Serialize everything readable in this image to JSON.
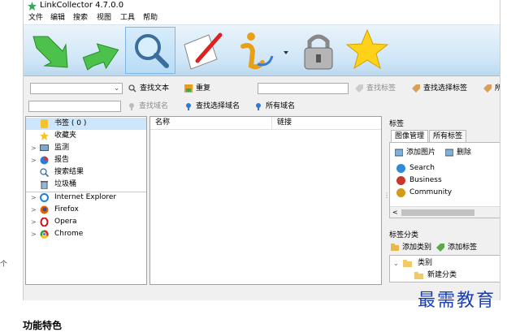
{
  "window": {
    "title": "LinkCollector 4.7.0.0"
  },
  "menu": [
    "文件",
    "编辑",
    "搜索",
    "视图",
    "工具",
    "帮助"
  ],
  "big_toolbar": [
    {
      "name": "arrow-down-right-icon"
    },
    {
      "name": "arrow-up-right-icon"
    },
    {
      "name": "magnifier-icon"
    },
    {
      "name": "paper-pencil-icon"
    },
    {
      "name": "info-icon"
    },
    {
      "name": "padlock-icon"
    },
    {
      "name": "star-icon"
    }
  ],
  "toolbar1": {
    "find_text": "查找文本",
    "duplicate": "重复",
    "find_tags": "查找标签",
    "find_selected_tags": "查找选择标签",
    "cut_label": "所"
  },
  "toolbar2": {
    "find_domain": "查找域名",
    "find_selected_domain": "查找选择域名",
    "all_domains": "所有域名"
  },
  "tree": [
    {
      "label": "书签 ( 0 )",
      "icon": "bookmark-icon",
      "arrow": "",
      "selected": true
    },
    {
      "label": "收藏夹",
      "icon": "star-icon",
      "arrow": "",
      "selected": false
    },
    {
      "label": "监测",
      "icon": "monitor-icon",
      "arrow": ">",
      "selected": false
    },
    {
      "label": "报告",
      "icon": "report-icon",
      "arrow": ">",
      "selected": false
    },
    {
      "label": "搜索结果",
      "icon": "search-icon",
      "arrow": "",
      "selected": false
    },
    {
      "label": "垃圾桶",
      "icon": "trash-icon",
      "arrow": "",
      "selected": false
    }
  ],
  "browsers": [
    {
      "label": "Internet Explorer",
      "icon": "ie-icon",
      "color": "#1e7fd6"
    },
    {
      "label": "Firefox",
      "icon": "firefox-icon",
      "color": "#e66000"
    },
    {
      "label": "Opera",
      "icon": "opera-icon",
      "color": "#cc0f16"
    },
    {
      "label": "Chrome",
      "icon": "chrome-icon",
      "color": "#2a9d3f"
    }
  ],
  "list_columns": {
    "name": "名称",
    "link": "链接"
  },
  "tags_panel": {
    "title": "标签",
    "tab_image": "图像管理",
    "tab_all": "所有标签",
    "add_image": "添加图片",
    "delete": "删除",
    "items": [
      {
        "label": "Search",
        "color": "#2e8bd8"
      },
      {
        "label": "Business",
        "color": "#c8382c"
      },
      {
        "label": "Community",
        "color": "#d49a1a"
      }
    ]
  },
  "category_panel": {
    "title": "标签分类",
    "add_category": "添加类别",
    "add_tag": "添加标签",
    "root": "类别",
    "child": "新建分类"
  },
  "left_edge_char": "个",
  "bottom_text": "功能特色",
  "watermark": "最需教育"
}
